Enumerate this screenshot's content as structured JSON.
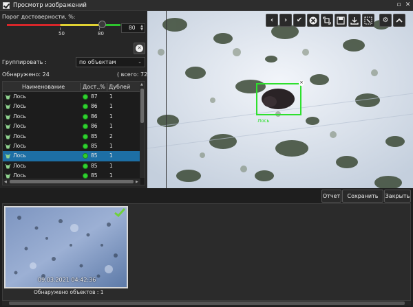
{
  "window": {
    "title": "Просмотр изображений"
  },
  "threshold": {
    "label": "Порог достоверности, %:",
    "value": "80",
    "tick_50": "50",
    "tick_80": "80"
  },
  "grouping": {
    "label": "Группировать :",
    "selected": "по объектам"
  },
  "summary": {
    "found_label": "Обнаружено:",
    "found_value": "24",
    "total": "( всего: 72 )"
  },
  "table": {
    "columns": [
      "Наименование",
      "Дост.,%",
      "Дублей"
    ],
    "rows": [
      {
        "name": "Лось",
        "conf": "87",
        "dups": "1",
        "selected": false
      },
      {
        "name": "Лось",
        "conf": "86",
        "dups": "1",
        "selected": false
      },
      {
        "name": "Лось",
        "conf": "86",
        "dups": "1",
        "selected": false
      },
      {
        "name": "Лось",
        "conf": "86",
        "dups": "1",
        "selected": false
      },
      {
        "name": "Лось",
        "conf": "85",
        "dups": "2",
        "selected": false
      },
      {
        "name": "Лось",
        "conf": "85",
        "dups": "1",
        "selected": false
      },
      {
        "name": "Лось",
        "conf": "85",
        "dups": "1",
        "selected": true
      },
      {
        "name": "Лось",
        "conf": "85",
        "dups": "1",
        "selected": false
      },
      {
        "name": "Лось",
        "conf": "85",
        "dups": "1",
        "selected": false
      }
    ]
  },
  "viewer": {
    "detection_label": "Лось"
  },
  "toolbar": {
    "icons": [
      "chevron-left-icon",
      "chevron-right-icon",
      "check-icon",
      "cancel-icon",
      "crop-select-icon",
      "save-icon",
      "download-icon",
      "frame-select-icon",
      "gear-icon",
      "chevron-up-icon"
    ]
  },
  "actions": {
    "report": "Отчет",
    "save_all": "Сохранить все",
    "close": "Закрыть"
  },
  "thumbnail": {
    "timestamp": "09.03.2021 04:42:36",
    "caption": "Обнаружено объектов : 1"
  },
  "colors": {
    "accent_green": "#2ee02e",
    "selection_blue": "#1d6fa5",
    "slider_red": "#d8262a",
    "slider_yellow": "#e0d232",
    "slider_green": "#2ec32e"
  }
}
